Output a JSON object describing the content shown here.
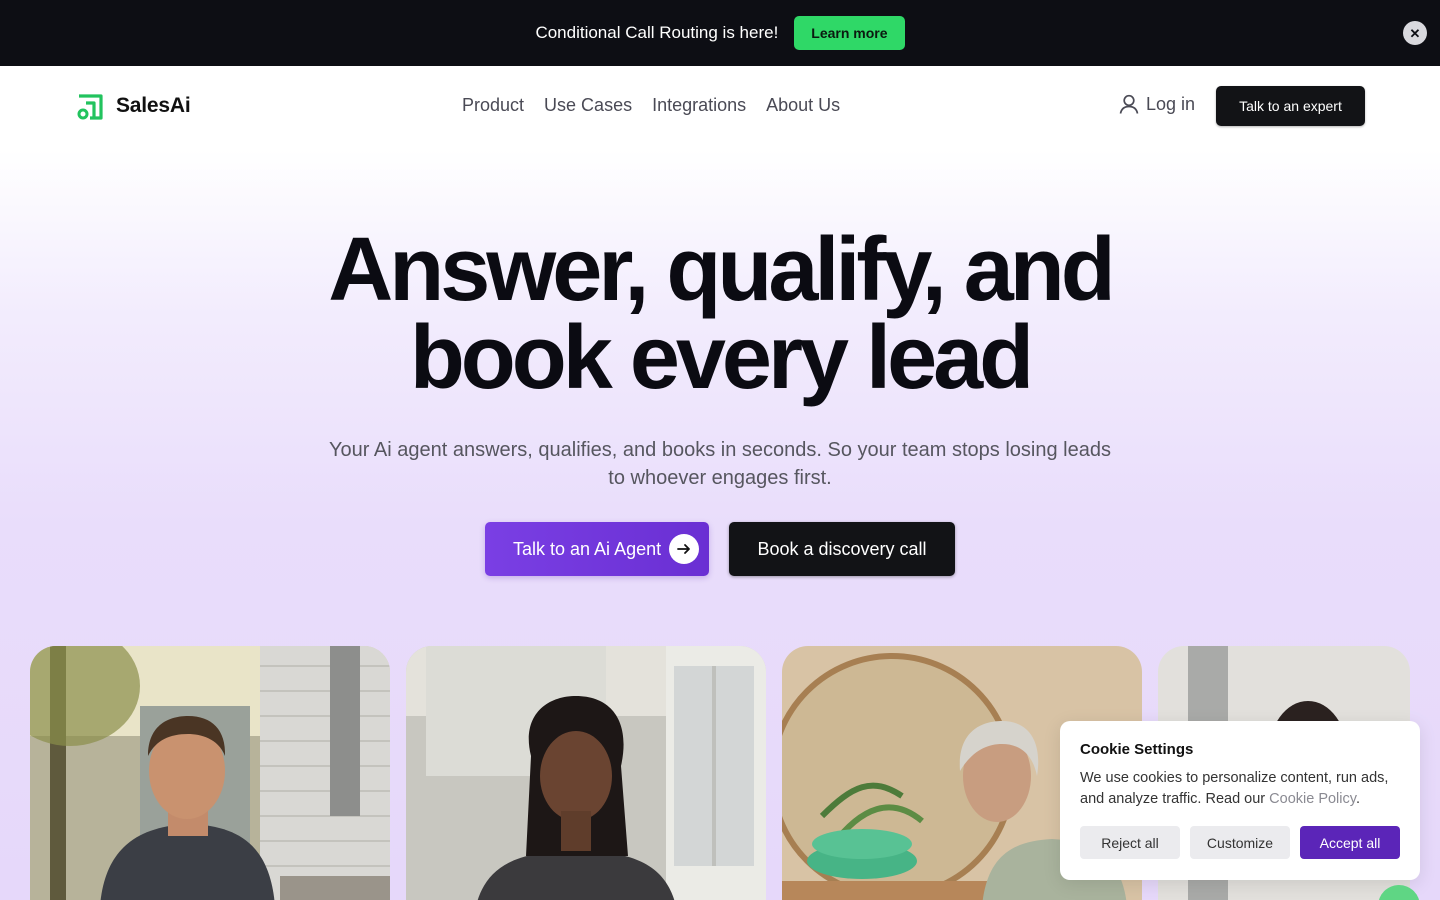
{
  "announcement": {
    "text": "Conditional Call Routing is here!",
    "button_label": "Learn more",
    "close_glyph": "✕"
  },
  "nav": {
    "brand": "SalesAi",
    "links": [
      "Product",
      "Use Cases",
      "Integrations",
      "About Us"
    ],
    "login_label": "Log in",
    "cta_label": "Talk to an expert"
  },
  "hero": {
    "headline_line1": "Answer, qualify, and",
    "headline_line2": "book every lead",
    "subhead": "Your Ai agent answers, qualifies, and books in seconds. So your team stops losing leads to whoever engages first.",
    "primary_cta": "Talk to an Ai Agent",
    "secondary_cta": "Book a discovery call"
  },
  "cookie": {
    "title": "Cookie Settings",
    "body": "We use cookies to personalize content, run ads, and analyze traffic. Read our ",
    "link": "Cookie Policy",
    "period": ".",
    "reject_label": "Reject all",
    "customize_label": "Customize",
    "accept_label": "Accept all"
  },
  "colors": {
    "accent_green": "#2fd867",
    "accent_purple": "#6a2fd3",
    "dark": "#121316"
  },
  "icons": [
    "close-icon",
    "logo-icon",
    "user-icon",
    "arrow-right-icon",
    "chat-icon"
  ]
}
